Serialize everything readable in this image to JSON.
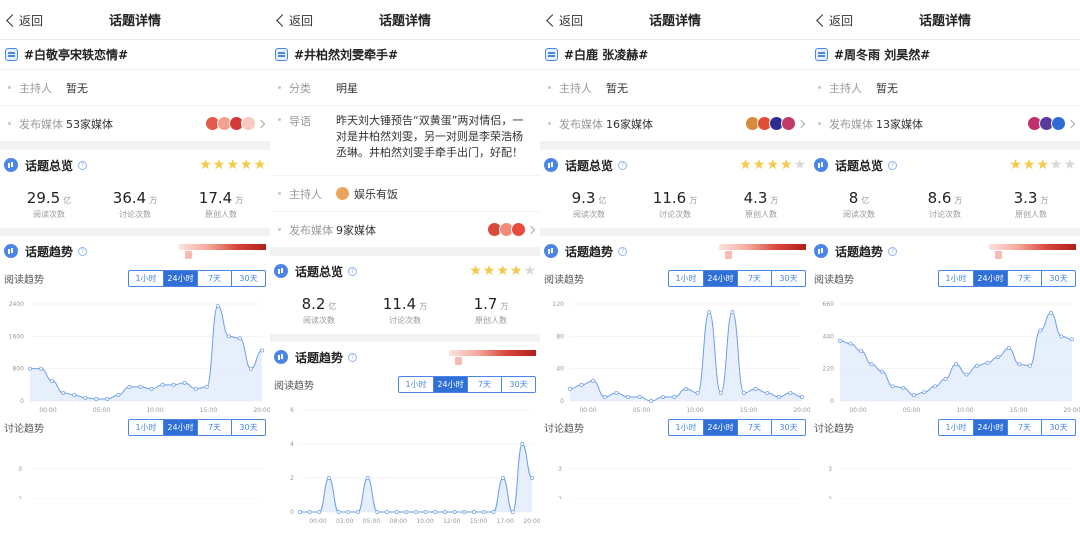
{
  "colors": {
    "accent": "#4a86e8",
    "tab_active": "#2f6fd6",
    "star_on": "#f7c948",
    "star_off": "#d8d8d8",
    "heat_high": "#b0201a"
  },
  "screens": [
    {
      "back_label": "返回",
      "nav_title": "话题详情",
      "topic": "#白敬亭宋轶恋情#",
      "info": [
        {
          "label": "主持人",
          "value": "暂无"
        },
        {
          "label": "发布媒体",
          "value": "53家媒体"
        }
      ],
      "overview_title": "话题总览",
      "stars": 5,
      "stats": [
        {
          "num": "29.5",
          "unit": "亿",
          "caption": "阅读次数"
        },
        {
          "num": "36.4",
          "unit": "万",
          "caption": "讨论次数"
        },
        {
          "num": "17.4",
          "unit": "万",
          "caption": "原创人数"
        }
      ],
      "trend_title": "话题趋势",
      "tabs": [
        "1小时",
        "24小时",
        "7天",
        "30天"
      ],
      "active_tab": 1,
      "read_label": "阅读趋势",
      "disc_label": "讨论趋势"
    },
    {
      "back_label": "返回",
      "nav_title": "话题详情",
      "topic": "#井柏然刘雯牵手#",
      "info": [
        {
          "label": "分类",
          "value": "明星"
        },
        {
          "label": "导语",
          "value": "昨天刘大锤预告“双黄蛋”两对情侣，一对是井柏然刘雯，另一对则是李荣浩杨丞琳。井柏然刘雯手牵手出门，好配！"
        },
        {
          "label": "主持人",
          "value": "娱乐有饭"
        },
        {
          "label": "发布媒体",
          "value": "9家媒体"
        }
      ],
      "overview_title": "话题总览",
      "stars": 4,
      "stats": [
        {
          "num": "8.2",
          "unit": "亿",
          "caption": "阅读次数"
        },
        {
          "num": "11.4",
          "unit": "万",
          "caption": "讨论次数"
        },
        {
          "num": "1.7",
          "unit": "万",
          "caption": "原创人数"
        }
      ],
      "trend_title": "话题趋势",
      "tabs": [
        "1小时",
        "24小时",
        "7天",
        "30天"
      ],
      "active_tab": 1,
      "read_label": "阅读趋势"
    },
    {
      "back_label": "返回",
      "nav_title": "话题详情",
      "topic": "#白鹿 张凌赫#",
      "info": [
        {
          "label": "主持人",
          "value": "暂无"
        },
        {
          "label": "发布媒体",
          "value": "16家媒体"
        }
      ],
      "overview_title": "话题总览",
      "stars": 4,
      "stats": [
        {
          "num": "9.3",
          "unit": "亿",
          "caption": "阅读次数"
        },
        {
          "num": "11.6",
          "unit": "万",
          "caption": "讨论次数"
        },
        {
          "num": "4.3",
          "unit": "万",
          "caption": "原创人数"
        }
      ],
      "trend_title": "话题趋势",
      "tabs": [
        "1小时",
        "24小时",
        "7天",
        "30天"
      ],
      "active_tab": 1,
      "read_label": "阅读趋势",
      "disc_label": "讨论趋势"
    },
    {
      "back_label": "返回",
      "nav_title": "话题详情",
      "topic": "#周冬雨 刘昊然#",
      "info": [
        {
          "label": "主持人",
          "value": "暂无"
        },
        {
          "label": "发布媒体",
          "value": "13家媒体"
        }
      ],
      "overview_title": "话题总览",
      "stars": 3,
      "stats": [
        {
          "num": "8",
          "unit": "亿",
          "caption": "阅读次数"
        },
        {
          "num": "8.6",
          "unit": "万",
          "caption": "讨论次数"
        },
        {
          "num": "3.3",
          "unit": "万",
          "caption": "原创人数"
        }
      ],
      "trend_title": "话题趋势",
      "tabs": [
        "1小时",
        "24小时",
        "7天",
        "30天"
      ],
      "active_tab": 1,
      "read_label": "阅读趋势",
      "disc_label": "讨论趋势"
    }
  ],
  "chart_data": [
    {
      "type": "area",
      "screen": 1,
      "name": "阅读趋势",
      "x": [
        "00:00",
        "",
        "05:00",
        "",
        "10:00",
        "",
        "15:00",
        "",
        "20:00"
      ],
      "x_ticks": [
        "00:00",
        "05:00",
        "10:00",
        "15:00",
        "20:00"
      ],
      "y_ticks": [
        0,
        800,
        1600,
        2400
      ],
      "ylim": [
        0,
        2400
      ],
      "values": [
        800,
        800,
        500,
        200,
        150,
        80,
        50,
        50,
        150,
        350,
        350,
        300,
        400,
        400,
        450,
        300,
        350,
        2350,
        1600,
        1550,
        800,
        1250
      ]
    },
    {
      "type": "line",
      "screen": 1,
      "name": "讨论趋势",
      "y_ticks": [
        2,
        3
      ],
      "values": []
    },
    {
      "type": "area",
      "screen": 2,
      "name": "阅读趋势",
      "x_ticks": [
        "00:00",
        "03:00",
        "05:00",
        "08:00",
        "10:00",
        "12:00",
        "15:00",
        "17:00",
        "20:00"
      ],
      "y_ticks": [
        0,
        2,
        4,
        6
      ],
      "ylim": [
        0,
        6
      ],
      "values": [
        0,
        0,
        0,
        2,
        0,
        0,
        0,
        2,
        0,
        0,
        0,
        0,
        0,
        0,
        0,
        0,
        0,
        0,
        0,
        0,
        0,
        2,
        0,
        4,
        2
      ]
    },
    {
      "type": "area",
      "screen": 3,
      "name": "阅读趋势",
      "x_ticks": [
        "00:00",
        "05:00",
        "10:00",
        "15:00",
        "20:00"
      ],
      "y_ticks": [
        0,
        40,
        80,
        120
      ],
      "ylim": [
        0,
        120
      ],
      "values": [
        15,
        20,
        25,
        5,
        10,
        5,
        5,
        0,
        5,
        5,
        15,
        10,
        110,
        10,
        110,
        10,
        15,
        10,
        5,
        10,
        5
      ]
    },
    {
      "type": "line",
      "screen": 3,
      "name": "讨论趋势",
      "y_ticks": [
        2,
        3
      ],
      "values": []
    },
    {
      "type": "area",
      "screen": 4,
      "name": "阅读趋势",
      "x_ticks": [
        "00:00",
        "05:00",
        "10:00",
        "15:00",
        "20:00"
      ],
      "y_ticks": [
        0,
        220,
        440,
        660
      ],
      "ylim": [
        0,
        660
      ],
      "values": [
        410,
        390,
        340,
        250,
        200,
        100,
        90,
        40,
        60,
        100,
        150,
        250,
        180,
        240,
        260,
        300,
        360,
        250,
        240,
        480,
        600,
        440,
        420
      ]
    },
    {
      "type": "line",
      "screen": 4,
      "name": "讨论趋势",
      "y_ticks": [
        2,
        3
      ],
      "values": []
    }
  ]
}
